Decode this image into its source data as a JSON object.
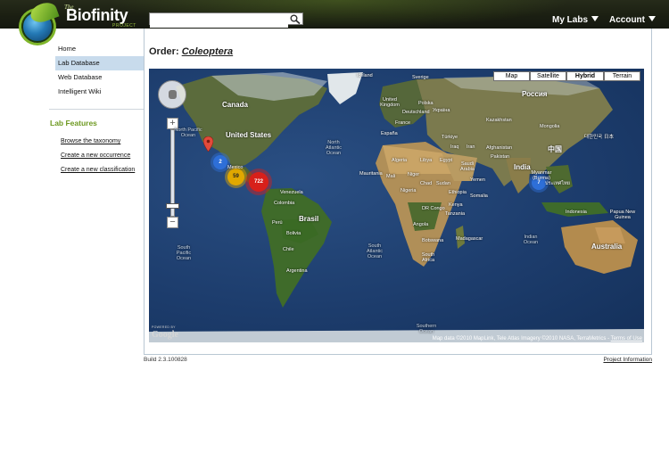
{
  "header": {
    "logo_the": "The",
    "logo_name": "Biofinity",
    "logo_sub": "PROJECT",
    "search": {
      "value": "",
      "placeholder": "",
      "icon": "search-icon"
    },
    "menus": [
      {
        "label": "My Labs",
        "icon": "caret-down-icon"
      },
      {
        "label": "Account",
        "icon": "caret-down-icon"
      }
    ]
  },
  "sidebar": {
    "nav": [
      {
        "label": "Home",
        "active": false
      },
      {
        "label": "Lab Database",
        "active": true
      },
      {
        "label": "Web Database",
        "active": false
      },
      {
        "label": "Intelligent Wiki",
        "active": false
      }
    ],
    "features_title": "Lab Features",
    "features": [
      {
        "label": "Browse the taxonomy"
      },
      {
        "label": "Create a new occurrence"
      },
      {
        "label": "Create a new classification"
      }
    ]
  },
  "main": {
    "title_prefix": "Order:",
    "title_taxon": "Coleoptera"
  },
  "map": {
    "types": [
      {
        "label": "Map",
        "selected": false
      },
      {
        "label": "Satellite",
        "selected": false
      },
      {
        "label": "Hybrid",
        "selected": true
      },
      {
        "label": "Terrain",
        "selected": false
      }
    ],
    "zoom_in": "+",
    "zoom_out": "−",
    "clusters": [
      {
        "count": "2",
        "color": "#2e6fd8"
      },
      {
        "count": "59",
        "color": "#e0a800"
      },
      {
        "count": "722",
        "color": "#d8201a"
      },
      {
        "count": "7",
        "color": "#2e6fd8"
      }
    ],
    "continents": {
      "canada": "Canada",
      "united_states": "United States",
      "mexico": "Mexico",
      "brasil": "Brasil",
      "peru": "Perú",
      "bolivia": "Bolivia",
      "argentina": "Argentina",
      "chile": "Chile",
      "venezuela": "Venezuela",
      "colombia": "Colombia",
      "australia": "Australia",
      "russia": "Россия",
      "china": "中国",
      "india": "India",
      "algeria": "Algeria",
      "libya": "Libya",
      "egypt": "Egypt",
      "niger": "Niger",
      "chad": "Chad",
      "sudan": "Sudan",
      "mali": "Mali",
      "nigeria": "Nigeria",
      "ethiopia": "Ethiopia",
      "kenya": "Kenya",
      "tanzania": "Tanzania",
      "dr_congo": "DR Congo",
      "angola": "Angola",
      "botswana": "Botswana",
      "south_africa": "South Africa",
      "madagascar": "Madagascar",
      "mauritania": "Mauritania",
      "saudi_arabia": "Saudi Arabia",
      "iran": "Iran",
      "iraq": "Iraq",
      "turkey": "Türkiye",
      "afghanistan": "Afghanistan",
      "pakistan": "Pakistan",
      "kazakhstan": "Kazakhstan",
      "mongolia": "Mongolia",
      "indonesia": "Indonesia",
      "papua_new_guinea": "Papua New Guinea",
      "sweden": "Sverige",
      "iceland": "Iceland",
      "united_kingdom": "United Kingdom",
      "france": "France",
      "espana": "España",
      "polska": "Polska",
      "ukraine": "Україна",
      "deutschland": "Deutschland",
      "korea": "대한민국",
      "japan": "日本",
      "thailand": "ประเทศไทย",
      "myanmar": "Myanmar (Burma)",
      "yemen": "Yemen",
      "somalia": "Somalia"
    },
    "oceans": {
      "north_pacific": "North Pacific Ocean",
      "north_atlantic": "North Atlantic Ocean",
      "south_pacific": "South Pacific Ocean",
      "south_atlantic": "South Atlantic Ocean",
      "indian": "Indian Ocean",
      "southern": "Southern Ocean"
    },
    "attribution_text": "Map data ©2010 MapLink, Tele Atlas Imagery ©2010 NASA, TerraMetrics - ",
    "terms": "Terms of Use",
    "powered_by": "POWERED BY",
    "google": "Google"
  },
  "footer": {
    "build": "Build 2.3.100828",
    "project_info": "Project Information"
  }
}
